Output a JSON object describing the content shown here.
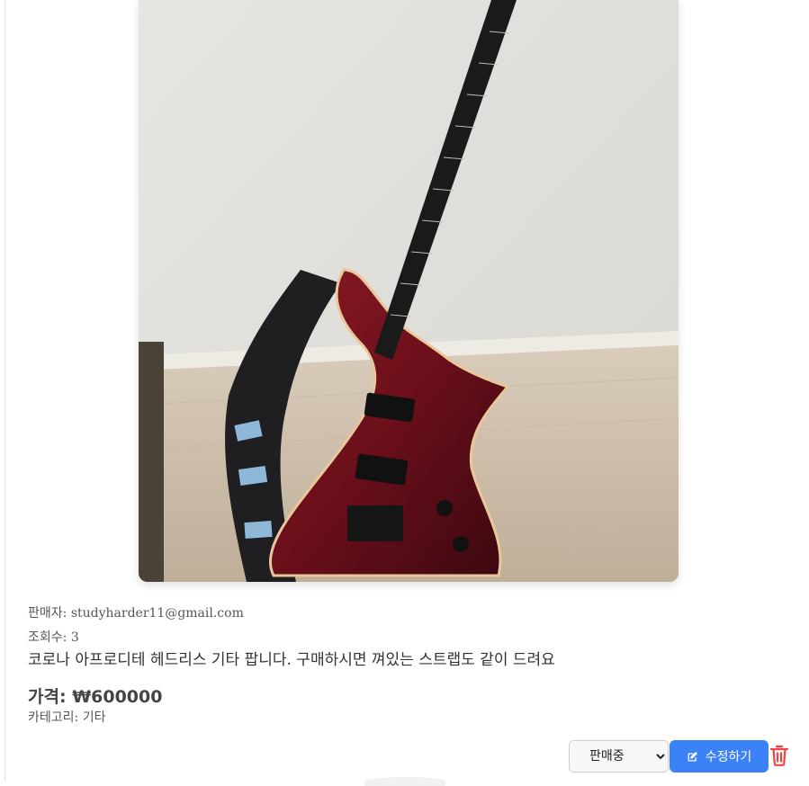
{
  "product": {
    "image_alt": "headless electric guitar photo",
    "seller_label": "판매자: ",
    "seller": "studyharder11@gmail.com",
    "views_label": "조회수: ",
    "views": "3",
    "description": "코로나 아프로디테 헤드리스 기타 팝니다. 구매하시면 껴있는 스트랩도 같이 드려요",
    "price_label": "가격: ",
    "price": "₩600000",
    "category_label": "카테고리: ",
    "category": "기타"
  },
  "actions": {
    "status_selected": "판매중",
    "edit_label": "수정하기",
    "edit_icon": "edit-icon",
    "delete_icon": "trash-icon"
  },
  "colors": {
    "accent": "#3b82f6",
    "danger": "#ef4444",
    "guitar_body": "#6b0f1a"
  }
}
